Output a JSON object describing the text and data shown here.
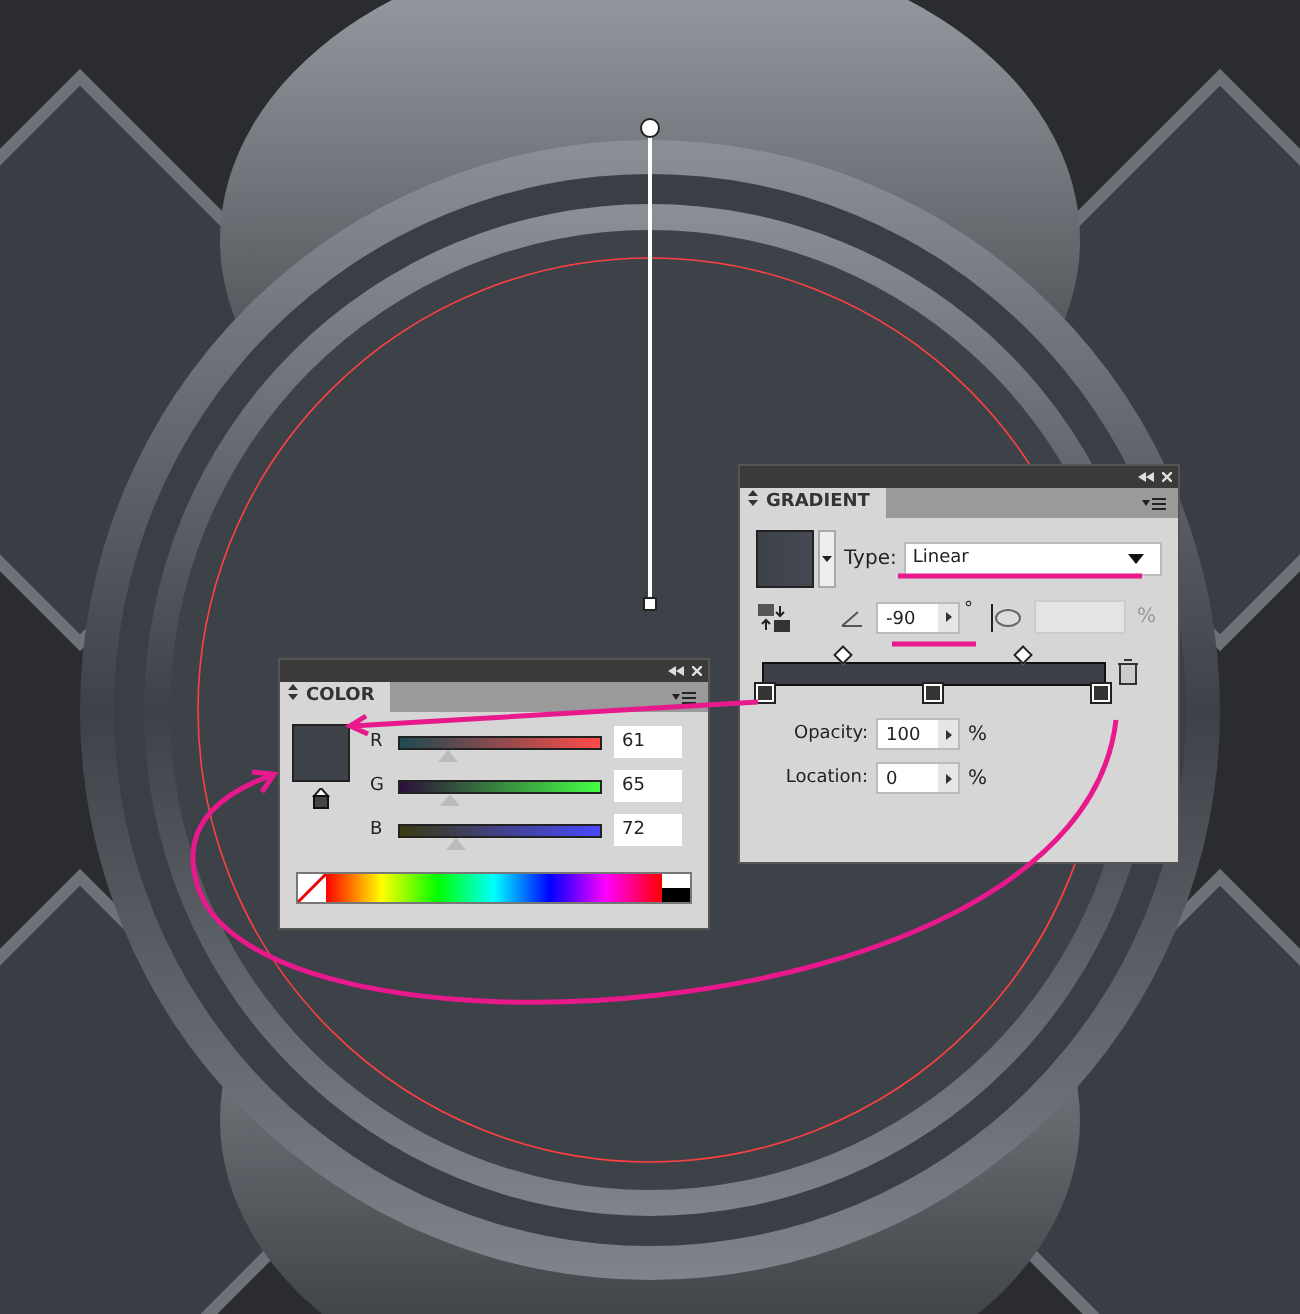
{
  "gradient_panel": {
    "title": "GRADIENT",
    "type_label": "Type:",
    "type_value": "Linear",
    "angle": "-90",
    "degree": "°",
    "aspect_unit": "%",
    "opacity_label": "Opacity:",
    "opacity": "100",
    "opacity_unit": "%",
    "location_label": "Location:",
    "location": "0",
    "location_unit": "%"
  },
  "color_panel": {
    "title": "COLOR",
    "channels": [
      {
        "name": "R",
        "value": "61",
        "level": 0.24
      },
      {
        "name": "G",
        "value": "65",
        "level": 0.25
      },
      {
        "name": "B",
        "value": "72",
        "level": 0.28
      }
    ]
  }
}
